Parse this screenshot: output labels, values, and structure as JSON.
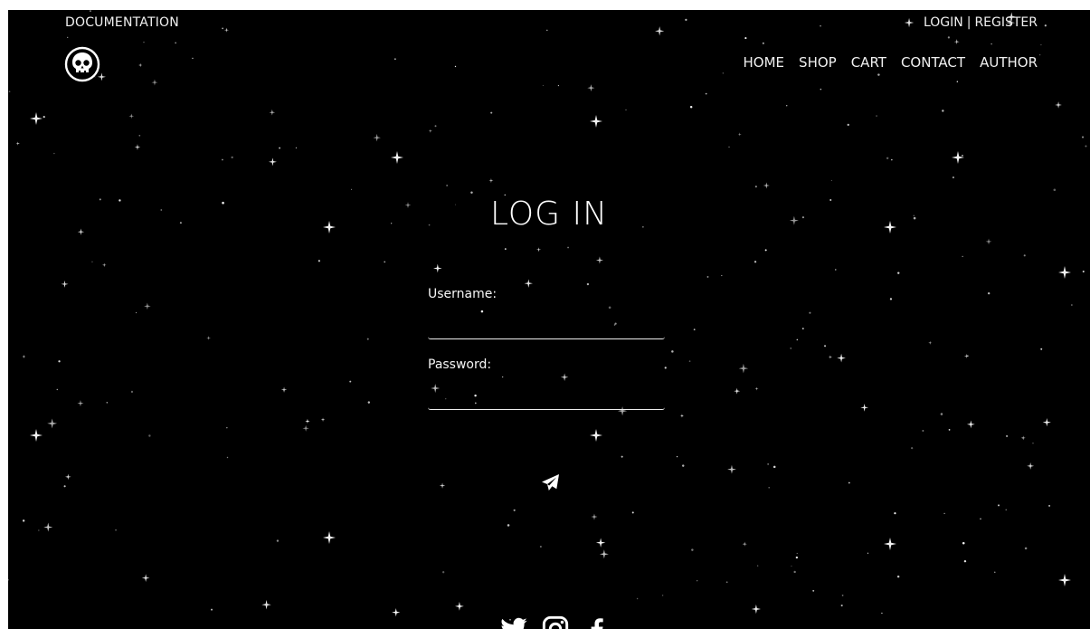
{
  "header": {
    "documentation_label": "DOCUMENTATION",
    "login_label": "LOGIN",
    "separator": "|",
    "register_label": "REGISTER"
  },
  "nav": {
    "items": [
      "HOME",
      "SHOP",
      "CART",
      "CONTACT",
      "AUTHOR"
    ]
  },
  "login": {
    "title": "LOG IN",
    "username_label": "Username:",
    "username_value": "",
    "password_label": "Password:",
    "password_value": ""
  },
  "icons": {
    "logo": "skull-icon",
    "submit": "paper-plane-icon",
    "social": [
      "twitter-icon",
      "instagram-icon",
      "facebook-icon"
    ]
  },
  "colors": {
    "background": "#000000",
    "text": "#f0f0f0"
  }
}
